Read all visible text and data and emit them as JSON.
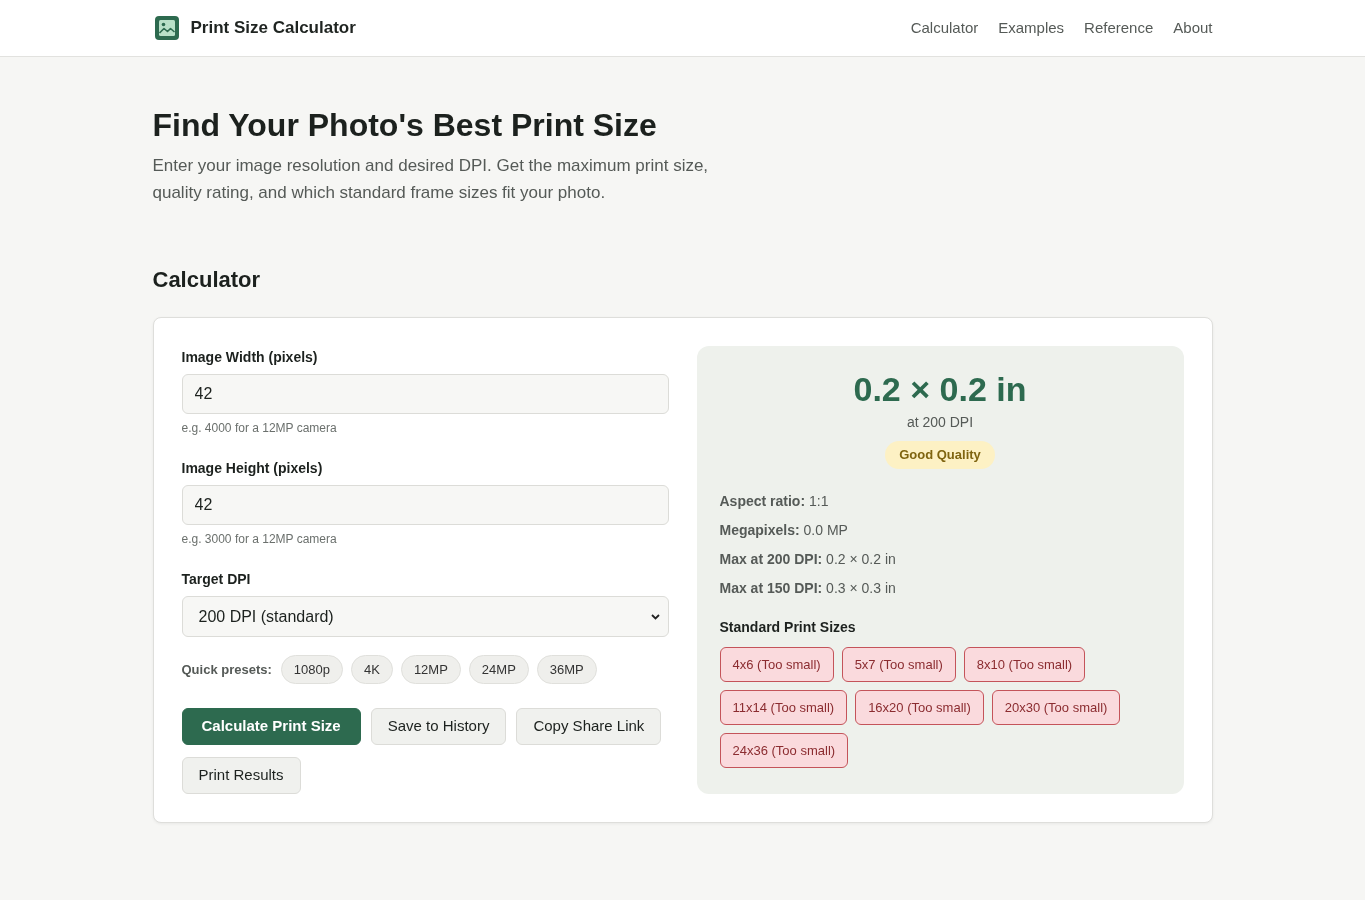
{
  "header": {
    "title": "Print Size Calculator",
    "nav": [
      "Calculator",
      "Examples",
      "Reference",
      "About"
    ]
  },
  "hero": {
    "heading": "Find Your Photo's Best Print Size",
    "intro": "Enter your image resolution and desired DPI. Get the maximum print size, quality rating, and which standard frame sizes fit your photo."
  },
  "section_title": "Calculator",
  "form": {
    "fields": [
      {
        "kind": "number",
        "label": "Image Width (pixels)",
        "value": "42",
        "hint": "e.g. 4000 for a 12MP camera"
      },
      {
        "kind": "number",
        "label": "Image Height (pixels)",
        "value": "42",
        "hint": "e.g. 3000 for a 12MP camera"
      },
      {
        "kind": "select",
        "label": "Target DPI",
        "value": "200 DPI (standard)"
      }
    ],
    "presets_label": "Quick presets:",
    "presets": [
      "1080p",
      "4K",
      "12MP",
      "24MP",
      "36MP"
    ],
    "buttons": [
      {
        "label": "Calculate Print Size",
        "primary": true
      },
      {
        "label": "Save to History",
        "primary": false
      },
      {
        "label": "Copy Share Link",
        "primary": false
      },
      {
        "label": "Print Results",
        "primary": false
      }
    ]
  },
  "result": {
    "size": "0.2 × 0.2 in",
    "dpi_note": "at 200 DPI",
    "quality": "Good Quality",
    "details": [
      "**Aspect ratio:** 1:1",
      "**Megapixels:** 0.0 MP",
      "**Max at 200 DPI:** 0.2 × 0.2 in",
      "**Max at 150 DPI:** 0.3 × 0.3 in"
    ],
    "sizes_title": "Standard Print Sizes",
    "sizes": [
      {
        "label": "4x6 (Too small)",
        "fits": false
      },
      {
        "label": "5x7 (Too small)",
        "fits": false
      },
      {
        "label": "8x10 (Too small)",
        "fits": false
      },
      {
        "label": "11x14 (Too small)",
        "fits": false
      },
      {
        "label": "16x20 (Too small)",
        "fits": false
      },
      {
        "label": "20x30 (Too small)",
        "fits": false
      },
      {
        "label": "24x36 (Too small)",
        "fits": false
      }
    ]
  }
}
